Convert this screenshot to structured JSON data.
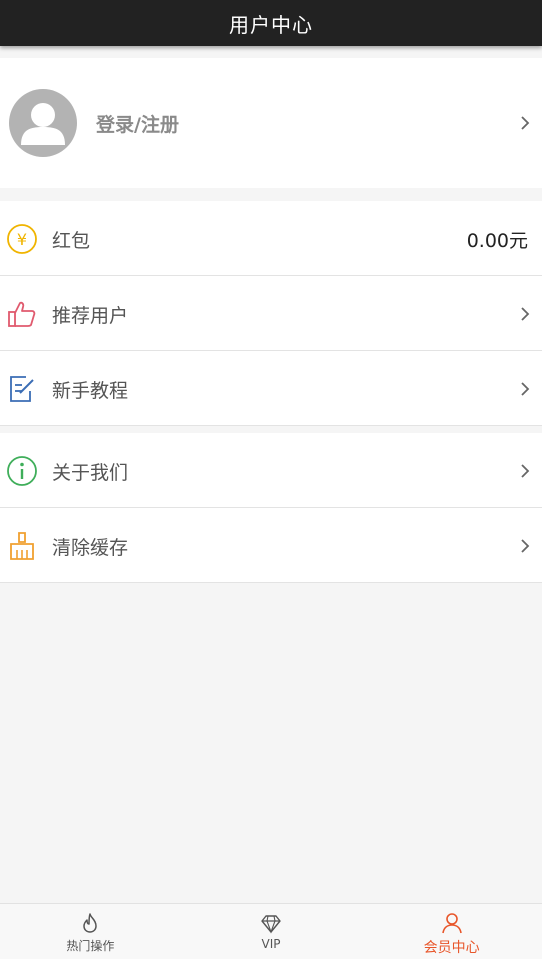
{
  "header": {
    "title": "用户中心"
  },
  "profile": {
    "label": "登录/注册"
  },
  "group1": [
    {
      "label": "红包",
      "value": "0.00元",
      "icon": "yen-coin-icon"
    },
    {
      "label": "推荐用户",
      "icon": "thumbs-up-icon"
    },
    {
      "label": "新手教程",
      "icon": "edit-document-icon"
    }
  ],
  "group2": [
    {
      "label": "关于我们",
      "icon": "info-circle-icon"
    },
    {
      "label": "清除缓存",
      "icon": "broom-icon"
    }
  ],
  "tabs": [
    {
      "label": "热门操作",
      "icon": "flame-icon"
    },
    {
      "label": "VIP",
      "icon": "diamond-icon"
    },
    {
      "label": "会员中心",
      "icon": "user-icon",
      "active": true
    }
  ],
  "colors": {
    "header_bg": "#222222",
    "accent": "#e8562a",
    "coin": "#f0b400",
    "thumbs": "#e05a6e",
    "tutorial": "#3b6db5",
    "info": "#3fae5a",
    "broom": "#f0a030"
  }
}
